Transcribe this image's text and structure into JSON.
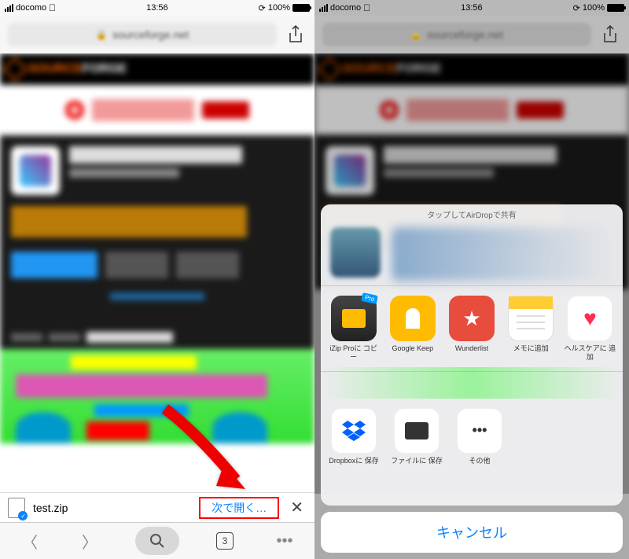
{
  "statusBar": {
    "carrier": "docomo",
    "time": "13:56",
    "battery": "100%"
  },
  "urlBar": {
    "domain": "sourceforge.net"
  },
  "siteHeader": {
    "brand1": "SOURCE",
    "brand2": "FORGE"
  },
  "downloadBar": {
    "filename": "test.zip",
    "openLabel": "次で開く…"
  },
  "toolbar": {
    "tabCount": "3"
  },
  "shareSheet": {
    "airdropHint": "タップしてAirDropで共有",
    "row1": [
      {
        "label": "iZip Proに\nコピー",
        "badge": "Pro"
      },
      {
        "label": "Google Keep"
      },
      {
        "label": "Wunderlist"
      },
      {
        "label": "メモに追加"
      },
      {
        "label": "ヘルスケアに\n追加"
      }
    ],
    "row2": [
      {
        "label": "Dropboxに\n保存"
      },
      {
        "label": "ファイルに\n保存"
      },
      {
        "label": "その他"
      }
    ],
    "cancel": "キャンセル"
  }
}
